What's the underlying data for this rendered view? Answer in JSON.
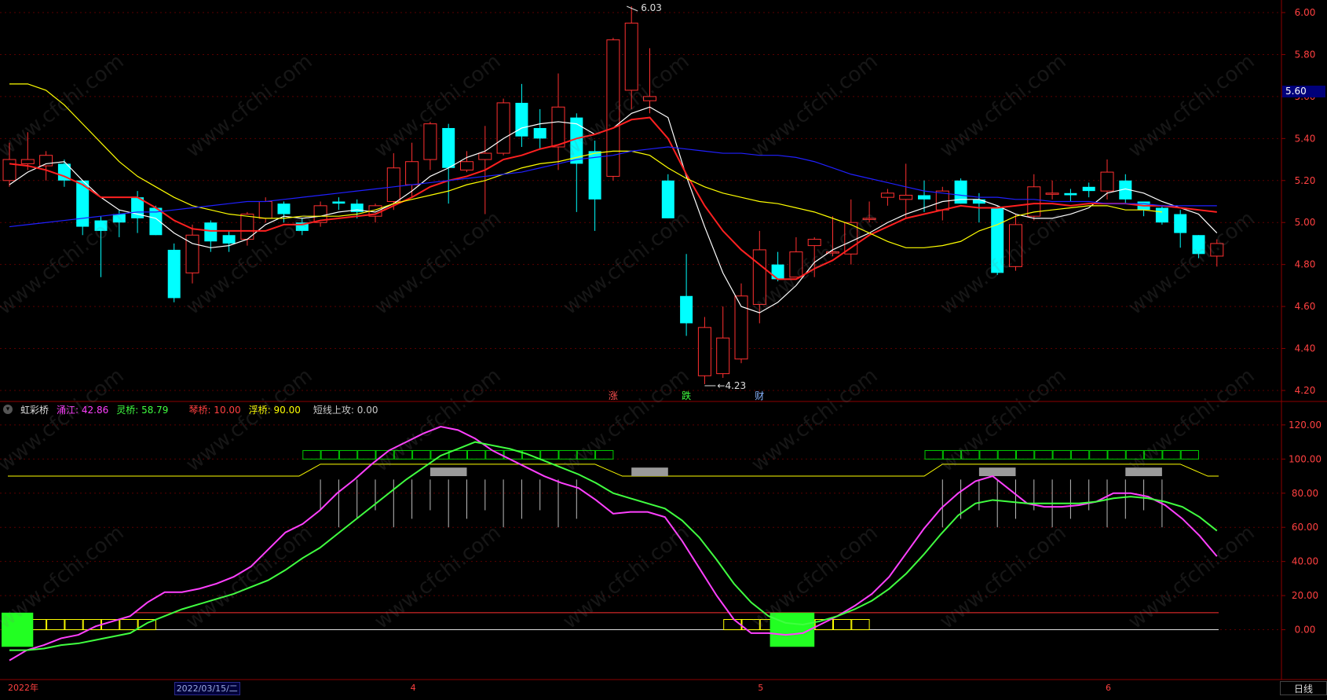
{
  "window": {
    "period_button": "日线",
    "price_tag": "5.60"
  },
  "watermark_text": "www.cfchi.com",
  "chart_data": [
    {
      "type": "candlestick",
      "ylim": [
        4.2,
        6.0
      ],
      "yticks": [
        "6.00",
        "5.80",
        "5.60",
        "5.40",
        "5.20",
        "5.00",
        "4.80",
        "4.60",
        "4.40",
        "4.20"
      ],
      "annotations": {
        "high_label": "6.03",
        "low_label": "4.23"
      },
      "markers": [
        {
          "label": "涨",
          "color": "#ff5050",
          "bar": 33
        },
        {
          "label": "跌",
          "color": "#40ff40",
          "bar": 37
        },
        {
          "label": "财",
          "color": "#8ab4ff",
          "bar": 41
        }
      ],
      "candles": [
        [
          5.2,
          5.3,
          5.38,
          5.17
        ],
        [
          5.28,
          5.3,
          5.43,
          5.25
        ],
        [
          5.27,
          5.32,
          5.34,
          5.2
        ],
        [
          5.28,
          5.2,
          5.3,
          5.17
        ],
        [
          5.2,
          4.98,
          5.2,
          4.94
        ],
        [
          5.01,
          4.96,
          5.03,
          4.74
        ],
        [
          5.04,
          5.0,
          5.06,
          4.93
        ],
        [
          5.12,
          5.02,
          5.15,
          4.95
        ],
        [
          5.07,
          4.94,
          5.08,
          4.94
        ],
        [
          4.87,
          4.64,
          4.9,
          4.62
        ],
        [
          4.76,
          4.94,
          4.99,
          4.71
        ],
        [
          5.0,
          4.91,
          5.01,
          4.86
        ],
        [
          4.94,
          4.9,
          4.96,
          4.86
        ],
        [
          4.92,
          5.04,
          5.05,
          4.89
        ],
        [
          5.02,
          5.1,
          5.12,
          5.0
        ],
        [
          5.09,
          5.04,
          5.1,
          5.0
        ],
        [
          5.0,
          4.96,
          5.02,
          4.94
        ],
        [
          5.0,
          5.08,
          5.1,
          4.98
        ],
        [
          5.1,
          5.09,
          5.12,
          5.06
        ],
        [
          5.09,
          5.05,
          5.11,
          5.02
        ],
        [
          5.03,
          5.08,
          5.09,
          5.0
        ],
        [
          5.1,
          5.26,
          5.33,
          5.06
        ],
        [
          5.18,
          5.29,
          5.38,
          5.12
        ],
        [
          5.3,
          5.47,
          5.48,
          5.25
        ],
        [
          5.45,
          5.26,
          5.47,
          5.09
        ],
        [
          5.25,
          5.29,
          5.34,
          5.24
        ],
        [
          5.3,
          5.33,
          5.46,
          5.04
        ],
        [
          5.33,
          5.57,
          5.59,
          5.32
        ],
        [
          5.57,
          5.41,
          5.66,
          5.36
        ],
        [
          5.45,
          5.4,
          5.54,
          5.35
        ],
        [
          5.36,
          5.55,
          5.71,
          5.25
        ],
        [
          5.5,
          5.28,
          5.52,
          5.05
        ],
        [
          5.34,
          5.11,
          5.39,
          4.96
        ],
        [
          5.22,
          5.87,
          5.88,
          5.2
        ],
        [
          5.63,
          5.95,
          6.03,
          5.54
        ],
        [
          5.58,
          5.6,
          5.83,
          5.52
        ],
        [
          5.2,
          5.02,
          5.23,
          5.02
        ],
        [
          4.65,
          4.52,
          4.85,
          4.46
        ],
        [
          4.27,
          4.5,
          4.55,
          4.23
        ],
        [
          4.28,
          4.45,
          4.6,
          4.26
        ],
        [
          4.35,
          4.65,
          4.71,
          4.33
        ],
        [
          4.61,
          4.87,
          4.96,
          4.52
        ],
        [
          4.8,
          4.73,
          4.86,
          4.72
        ],
        [
          4.74,
          4.86,
          4.93,
          4.74
        ],
        [
          4.89,
          4.92,
          4.93,
          4.74
        ],
        [
          4.86,
          4.86,
          5.03,
          4.84
        ],
        [
          4.85,
          5.0,
          5.11,
          4.8
        ],
        [
          5.02,
          5.02,
          5.1,
          5.0
        ],
        [
          5.12,
          5.14,
          5.16,
          5.08
        ],
        [
          5.11,
          5.13,
          5.28,
          5.02
        ],
        [
          5.13,
          5.11,
          5.2,
          5.05
        ],
        [
          5.06,
          5.15,
          5.17,
          5.01
        ],
        [
          5.2,
          5.09,
          5.21,
          5.09
        ],
        [
          5.11,
          5.09,
          5.14,
          5.0
        ],
        [
          5.07,
          4.76,
          5.08,
          4.75
        ],
        [
          4.79,
          4.99,
          5.04,
          4.77
        ],
        [
          5.03,
          5.17,
          5.23,
          5.01
        ],
        [
          5.14,
          5.14,
          5.2,
          5.11
        ],
        [
          5.14,
          5.13,
          5.16,
          5.1
        ],
        [
          5.17,
          5.15,
          5.19,
          5.12
        ],
        [
          5.15,
          5.24,
          5.3,
          5.11
        ],
        [
          5.2,
          5.11,
          5.23,
          5.09
        ],
        [
          5.1,
          5.06,
          5.09,
          5.03
        ],
        [
          5.07,
          5.0,
          5.08,
          4.99
        ],
        [
          5.04,
          4.95,
          5.06,
          4.88
        ],
        [
          4.94,
          4.85,
          4.94,
          4.83
        ],
        [
          4.84,
          4.9,
          4.92,
          4.79
        ]
      ],
      "ma": [
        {
          "color": "#ffffff",
          "values": [
            5.18,
            5.24,
            5.28,
            5.29,
            5.2,
            5.12,
            5.06,
            5.04,
            5.02,
            4.95,
            4.9,
            4.88,
            4.89,
            4.92,
            4.99,
            5.03,
            5.02,
            5.03,
            5.05,
            5.06,
            5.05,
            5.09,
            5.15,
            5.22,
            5.26,
            5.31,
            5.34,
            5.4,
            5.45,
            5.47,
            5.48,
            5.47,
            5.42,
            5.45,
            5.52,
            5.55,
            5.5,
            5.22,
            4.98,
            4.76,
            4.6,
            4.57,
            4.62,
            4.7,
            4.81,
            4.87,
            4.91,
            4.95,
            5.0,
            5.04,
            5.07,
            5.1,
            5.11,
            5.11,
            5.08,
            5.04,
            5.02,
            5.02,
            5.04,
            5.07,
            5.14,
            5.16,
            5.14,
            5.1,
            5.07,
            5.04,
            4.95
          ]
        },
        {
          "color": "#ff2020",
          "values": [
            5.28,
            5.27,
            5.25,
            5.22,
            5.18,
            5.12,
            5.12,
            5.12,
            5.07,
            5.01,
            4.97,
            4.96,
            4.96,
            4.96,
            4.96,
            4.99,
            4.99,
            5.01,
            5.02,
            5.03,
            5.04,
            5.08,
            5.12,
            5.17,
            5.2,
            5.22,
            5.25,
            5.3,
            5.32,
            5.35,
            5.37,
            5.4,
            5.42,
            5.45,
            5.49,
            5.5,
            5.4,
            5.23,
            5.08,
            4.96,
            4.87,
            4.8,
            4.73,
            4.73,
            4.78,
            4.82,
            4.88,
            4.94,
            4.98,
            5.02,
            5.04,
            5.06,
            5.08,
            5.07,
            5.07,
            5.08,
            5.09,
            5.09,
            5.08,
            5.09,
            5.09,
            5.09,
            5.08,
            5.08,
            5.07,
            5.06,
            5.05
          ]
        },
        {
          "color": "#ffff00",
          "values": [
            5.66,
            5.66,
            5.63,
            5.56,
            5.47,
            5.38,
            5.29,
            5.22,
            5.17,
            5.12,
            5.08,
            5.06,
            5.04,
            5.03,
            5.02,
            5.02,
            5.03,
            5.03,
            5.03,
            5.04,
            5.06,
            5.09,
            5.11,
            5.13,
            5.15,
            5.18,
            5.2,
            5.23,
            5.26,
            5.28,
            5.29,
            5.31,
            5.33,
            5.34,
            5.34,
            5.32,
            5.26,
            5.21,
            5.17,
            5.14,
            5.12,
            5.1,
            5.09,
            5.07,
            5.05,
            5.02,
            4.99,
            4.95,
            4.91,
            4.88,
            4.88,
            4.89,
            4.91,
            4.96,
            4.99,
            5.03,
            5.05,
            5.06,
            5.07,
            5.08,
            5.08,
            5.06,
            5.06,
            5.05
          ]
        },
        {
          "color": "#2020ff",
          "values": [
            4.98,
            4.99,
            5.0,
            5.01,
            5.02,
            5.03,
            5.04,
            5.05,
            5.05,
            5.06,
            5.07,
            5.08,
            5.09,
            5.1,
            5.1,
            5.11,
            5.12,
            5.13,
            5.14,
            5.15,
            5.16,
            5.17,
            5.18,
            5.19,
            5.2,
            5.21,
            5.22,
            5.23,
            5.24,
            5.26,
            5.28,
            5.3,
            5.31,
            5.32,
            5.34,
            5.35,
            5.36,
            5.35,
            5.34,
            5.33,
            5.33,
            5.32,
            5.32,
            5.31,
            5.29,
            5.26,
            5.23,
            5.21,
            5.19,
            5.17,
            5.15,
            5.14,
            5.13,
            5.12,
            5.12,
            5.11,
            5.11,
            5.1,
            5.1,
            5.1,
            5.09,
            5.09,
            5.09,
            5.08,
            5.08,
            5.08,
            5.08
          ]
        }
      ]
    },
    {
      "type": "line",
      "title": "虹彩桥",
      "legend": [
        {
          "label": "涌江: 42.86",
          "color": "#ff40ff"
        },
        {
          "label": "灵桥: 58.79",
          "color": "#40ff40"
        },
        {
          "label": "琴桥: 10.00",
          "color": "#ff4040"
        },
        {
          "label": "浮桥: 90.00",
          "color": "#ffff00"
        },
        {
          "label": "短线上攻: 0.00",
          "color": "#c8c8c8"
        }
      ],
      "ylim": [
        -20,
        125
      ],
      "yticks": [
        "120.00",
        "100.00",
        "80.00",
        "60.00",
        "40.00",
        "20.00",
        "0.00"
      ],
      "series": [
        {
          "name": "涌江",
          "color": "#ff40ff",
          "values": [
            -18,
            -12,
            -9,
            -5,
            -3,
            2,
            5,
            8,
            16,
            22,
            22,
            24,
            27,
            31,
            37,
            47,
            57,
            62,
            70,
            80,
            88,
            97,
            105,
            110,
            115,
            119,
            117,
            112,
            105,
            100,
            95,
            90,
            86,
            83,
            76,
            68,
            69,
            69,
            66,
            52,
            36,
            20,
            6,
            -2,
            -2,
            -3,
            -2,
            3,
            8,
            14,
            21,
            31,
            45,
            59,
            71,
            80,
            87,
            90,
            82,
            74,
            72,
            72,
            73,
            75,
            80,
            80,
            78,
            73,
            65,
            55,
            43
          ]
        },
        {
          "name": "灵桥",
          "color": "#40ff40",
          "values": [
            -12,
            -12,
            -11,
            -9,
            -8,
            -6,
            -4,
            -2,
            4,
            8,
            12,
            15,
            18,
            21,
            25,
            29,
            35,
            42,
            48,
            56,
            64,
            72,
            80,
            88,
            95,
            102,
            106,
            110,
            108,
            106,
            103,
            99,
            95,
            91,
            86,
            80,
            77,
            74,
            71,
            64,
            54,
            41,
            27,
            16,
            8,
            4,
            3,
            5,
            8,
            12,
            17,
            24,
            33,
            44,
            56,
            67,
            74,
            76,
            75,
            74,
            74,
            74,
            74,
            75,
            77,
            78,
            77,
            75,
            72,
            66,
            58
          ]
        }
      ],
      "bridge_boxes": [
        {
          "top": 105,
          "bottom": 100,
          "from": 16,
          "to": 33,
          "color": "#00cc00"
        },
        {
          "top": 105,
          "bottom": 100,
          "from": 50,
          "to": 65,
          "color": "#00cc00"
        },
        {
          "top": 6,
          "bottom": 0,
          "from": 1,
          "to": 8,
          "color": "#ffff00"
        },
        {
          "top": 6,
          "bottom": 0,
          "from": 39,
          "to": 47,
          "color": "#ffff00"
        }
      ],
      "green_blocks": [
        {
          "top": 10,
          "bottom": -10,
          "from": 0,
          "to": 1.3
        },
        {
          "top": 10,
          "bottom": -10,
          "from": 42,
          "to": 44
        }
      ],
      "gray_blocks": [
        {
          "top": 95,
          "bottom": 90,
          "from": 23,
          "to": 25
        },
        {
          "top": 95,
          "bottom": 90,
          "from": 34,
          "to": 36
        },
        {
          "top": 95,
          "bottom": 90,
          "from": 53,
          "to": 55
        },
        {
          "top": 95,
          "bottom": 90,
          "from": 61,
          "to": 63
        }
      ],
      "x_labels": [
        {
          "text": "2022年",
          "bar": 0,
          "color": "#ff4040"
        },
        {
          "text": "2022/03/15/二",
          "bar": 9,
          "color": "#9ad",
          "cursor": true
        },
        {
          "text": "4",
          "bar": 22,
          "color": "#ff4040"
        },
        {
          "text": "5",
          "bar": 41,
          "color": "#ff4040"
        },
        {
          "text": "6",
          "bar": 60,
          "color": "#ff4040"
        }
      ]
    }
  ]
}
